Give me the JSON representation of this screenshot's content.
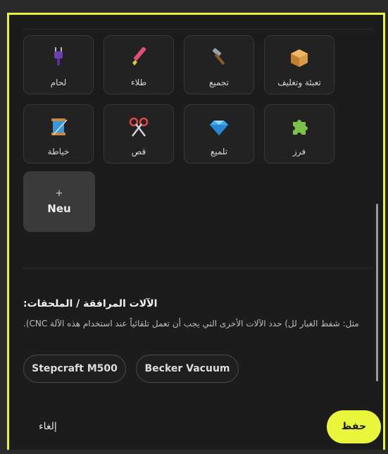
{
  "categories": [
    {
      "id": "packaging",
      "label": "تعبئة وتغليف",
      "icon": "package-icon"
    },
    {
      "id": "assembly",
      "label": "تجميع",
      "icon": "hammer-icon"
    },
    {
      "id": "painting",
      "label": "طلاء",
      "icon": "paintbrush-icon"
    },
    {
      "id": "welding",
      "label": "لحام",
      "icon": "plug-icon"
    },
    {
      "id": "milling",
      "label": "فرز",
      "icon": "puzzle-icon"
    },
    {
      "id": "polishing",
      "label": "تلميع",
      "icon": "diamond-icon"
    },
    {
      "id": "cutting",
      "label": "قص",
      "icon": "scissors-icon"
    },
    {
      "id": "sewing",
      "label": "خياطة",
      "icon": "thread-spool-icon"
    }
  ],
  "new_tile": {
    "plus": "+",
    "label": "Neu"
  },
  "accessories": {
    "title": "الآلات المرافقة / الملحقات:",
    "description": "مثل: شفط الغبار لل) حدد الآلات الأخرى التي يجب أن تعمل تلقائياً عند استخدام هذه الآلة CNC).",
    "chips": [
      "Stepcraft M500",
      "Becker Vacuum"
    ]
  },
  "footer": {
    "cancel_label": "إلغاء",
    "save_label": "حفظ"
  },
  "colors": {
    "accent": "#e8f53a",
    "panel": "#1c1c1c",
    "tile": "#222222"
  }
}
